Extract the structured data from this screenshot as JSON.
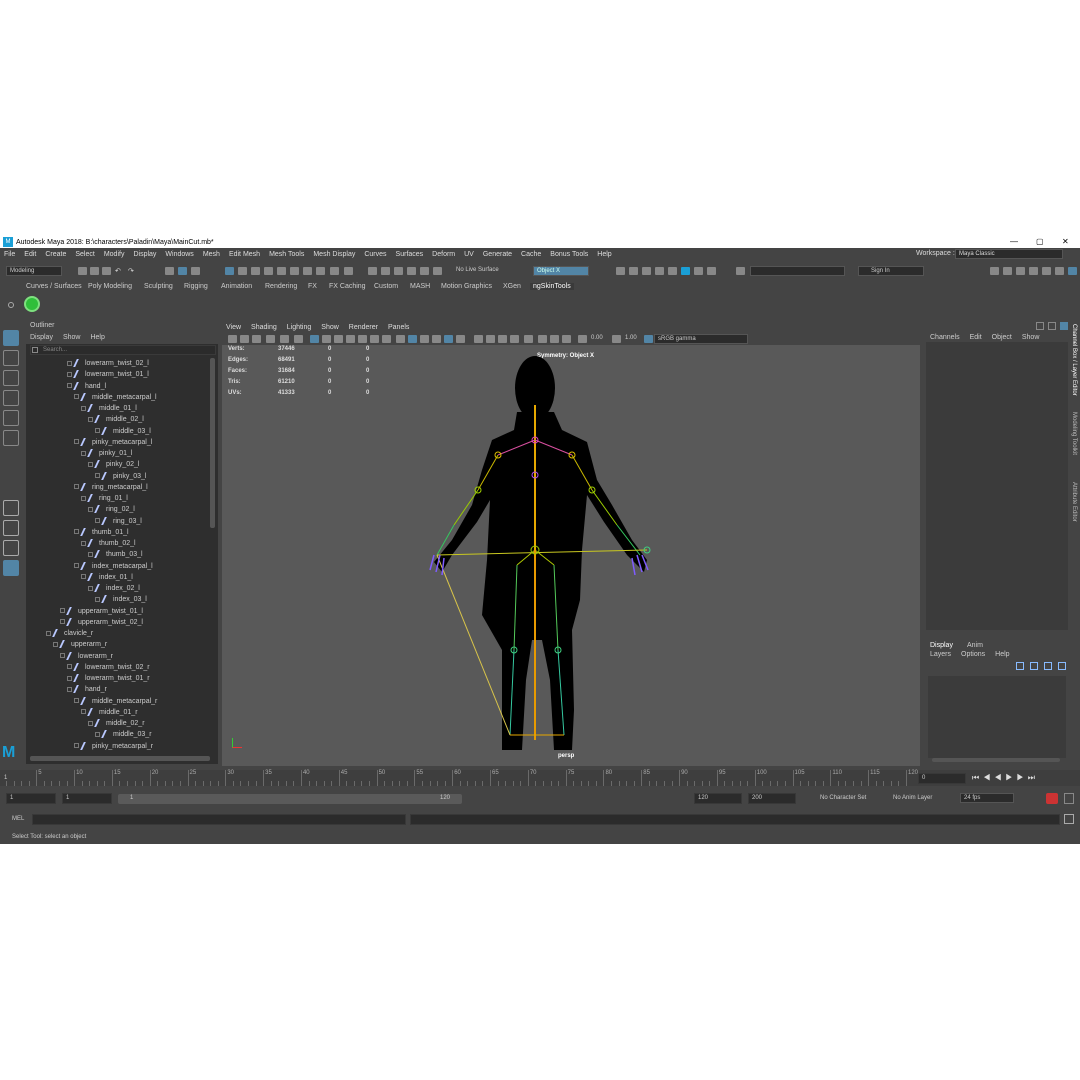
{
  "window": {
    "title": "Autodesk Maya 2018: B:\\characters\\Paladin\\Maya\\MainCut.mb*",
    "minimize": "—",
    "maximize": "▢",
    "close": "✕"
  },
  "menubar": [
    "File",
    "Edit",
    "Create",
    "Select",
    "Modify",
    "Display",
    "Windows",
    "Mesh",
    "Edit Mesh",
    "Mesh Tools",
    "Mesh Display",
    "Curves",
    "Surfaces",
    "Deform",
    "UV",
    "Generate",
    "Cache",
    "Bonus Tools",
    "Help"
  ],
  "workspace": {
    "label": "Workspace :",
    "value": "Maya Classic"
  },
  "statusline": {
    "mode": "Modeling",
    "live_surface": "No Live Surface",
    "object_field": "Object X",
    "sign_in": "Sign In"
  },
  "shelf_tabs": [
    "Curves / Surfaces",
    "Poly Modeling",
    "Sculpting",
    "Rigging",
    "Animation",
    "Rendering",
    "FX",
    "FX Caching",
    "Custom",
    "MASH",
    "Motion Graphics",
    "XGen",
    "ngSkinTools"
  ],
  "outliner": {
    "title": "Outliner",
    "menu": [
      "Display",
      "Show",
      "Help"
    ],
    "search_placeholder": "Search...",
    "nodes": [
      {
        "label": "lowerarm_twist_02_l",
        "depth": 5
      },
      {
        "label": "lowerarm_twist_01_l",
        "depth": 5
      },
      {
        "label": "hand_l",
        "depth": 5
      },
      {
        "label": "middle_metacarpal_l",
        "depth": 6
      },
      {
        "label": "middle_01_l",
        "depth": 7
      },
      {
        "label": "middle_02_l",
        "depth": 8
      },
      {
        "label": "middle_03_l",
        "depth": 9
      },
      {
        "label": "pinky_metacarpal_l",
        "depth": 6
      },
      {
        "label": "pinky_01_l",
        "depth": 7
      },
      {
        "label": "pinky_02_l",
        "depth": 8
      },
      {
        "label": "pinky_03_l",
        "depth": 9
      },
      {
        "label": "ring_metacarpal_l",
        "depth": 6
      },
      {
        "label": "ring_01_l",
        "depth": 7
      },
      {
        "label": "ring_02_l",
        "depth": 8
      },
      {
        "label": "ring_03_l",
        "depth": 9
      },
      {
        "label": "thumb_01_l",
        "depth": 6
      },
      {
        "label": "thumb_02_l",
        "depth": 7
      },
      {
        "label": "thumb_03_l",
        "depth": 8
      },
      {
        "label": "index_metacarpal_l",
        "depth": 6
      },
      {
        "label": "index_01_l",
        "depth": 7
      },
      {
        "label": "index_02_l",
        "depth": 8
      },
      {
        "label": "index_03_l",
        "depth": 9
      },
      {
        "label": "upperarm_twist_01_l",
        "depth": 4
      },
      {
        "label": "upperarm_twist_02_l",
        "depth": 4
      },
      {
        "label": "clavicle_r",
        "depth": 2
      },
      {
        "label": "upperarm_r",
        "depth": 3
      },
      {
        "label": "lowerarm_r",
        "depth": 4
      },
      {
        "label": "lowerarm_twist_02_r",
        "depth": 5
      },
      {
        "label": "lowerarm_twist_01_r",
        "depth": 5
      },
      {
        "label": "hand_r",
        "depth": 5
      },
      {
        "label": "middle_metacarpal_r",
        "depth": 6
      },
      {
        "label": "middle_01_r",
        "depth": 7
      },
      {
        "label": "middle_02_r",
        "depth": 8
      },
      {
        "label": "middle_03_r",
        "depth": 9
      },
      {
        "label": "pinky_metacarpal_r",
        "depth": 6
      }
    ]
  },
  "viewport": {
    "menu": [
      "View",
      "Shading",
      "Lighting",
      "Show",
      "Renderer",
      "Panels"
    ],
    "field_a": "0.00",
    "field_b": "1.00",
    "color_space": "sRGB gamma",
    "stats": [
      {
        "k": "Verts:",
        "v": "37446",
        "a": "0",
        "b": "0"
      },
      {
        "k": "Edges:",
        "v": "68491",
        "a": "0",
        "b": "0"
      },
      {
        "k": "Faces:",
        "v": "31684",
        "a": "0",
        "b": "0"
      },
      {
        "k": "Tris:",
        "v": "61210",
        "a": "0",
        "b": "0"
      },
      {
        "k": "UVs:",
        "v": "41333",
        "a": "0",
        "b": "0"
      }
    ],
    "symmetry": "Symmetry: Object X",
    "camera": "persp"
  },
  "channel_box": {
    "menu": [
      "Channels",
      "Edit",
      "Object",
      "Show"
    ]
  },
  "layer_editor": {
    "tabs": [
      "Display",
      "Anim"
    ],
    "menu": [
      "Layers",
      "Options",
      "Help"
    ]
  },
  "side_tabs": [
    "Channel Box / Layer Editor",
    "Modeling Toolkit",
    "Attribute Editor"
  ],
  "timeline": {
    "ticks": [
      "5",
      "10",
      "15",
      "20",
      "25",
      "30",
      "35",
      "40",
      "45",
      "50",
      "55",
      "60",
      "65",
      "70",
      "75",
      "80",
      "85",
      "90",
      "95",
      "100",
      "105",
      "110",
      "115",
      "120"
    ],
    "start": "1",
    "current": "0"
  },
  "range": {
    "start": "1",
    "start2": "1",
    "slider_start": "1",
    "slider_end": "120",
    "end": "120",
    "end2": "200",
    "character_set": "No Character Set",
    "anim_layer": "No Anim Layer",
    "fps": "24 fps"
  },
  "command": {
    "label": "MEL"
  },
  "help_line": "Select Tool: select an object",
  "colors": {
    "accent": "#5285a6",
    "ui_bg": "#444444",
    "viewport_bg": "#595959",
    "outliner_bg": "#2e2e2e"
  }
}
